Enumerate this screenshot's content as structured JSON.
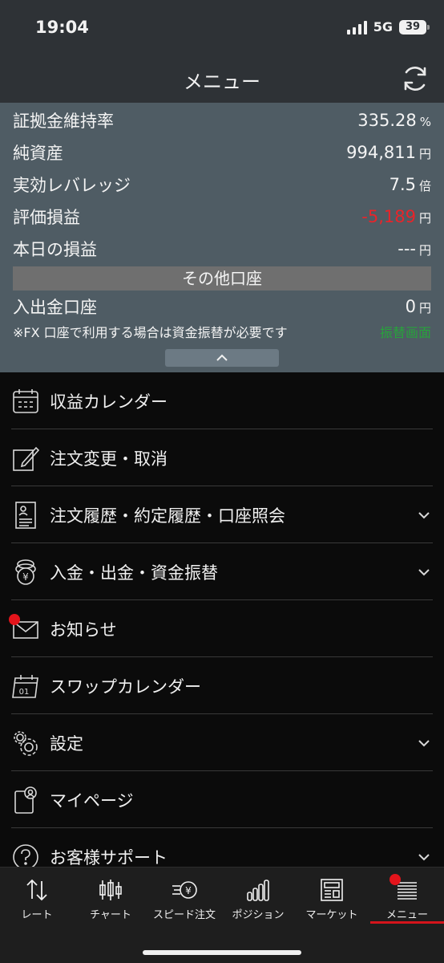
{
  "status": {
    "time": "19:04",
    "network": "5G",
    "battery": "39"
  },
  "header": {
    "title": "メニュー"
  },
  "account": {
    "rows": [
      {
        "label": "証拠金維持率",
        "value": "335.28",
        "unit": "%"
      },
      {
        "label": "純資産",
        "value": "994,811",
        "unit": "円"
      },
      {
        "label": "実効レバレッジ",
        "value": "7.5",
        "unit": "倍"
      },
      {
        "label": "評価損益",
        "value": "-5,189",
        "unit": "円"
      },
      {
        "label": "本日の損益",
        "value": "---",
        "unit": "円"
      }
    ],
    "other_section": "その他口座",
    "deposit_row": {
      "label": "入出金口座",
      "value": "0",
      "unit": "円"
    },
    "note": "※FX 口座で利用する場合は資金振替が必要です",
    "transfer_link": "振替画面"
  },
  "menu": {
    "items": [
      {
        "label": "収益カレンダー",
        "icon": "calendar-icon"
      },
      {
        "label": "注文変更・取消",
        "icon": "edit-icon"
      },
      {
        "label": "注文履歴・約定履歴・口座照会",
        "icon": "document-icon"
      },
      {
        "label": "入金・出金・資金振替",
        "icon": "coins-icon"
      },
      {
        "label": "お知らせ",
        "icon": "mail-icon"
      },
      {
        "label": "スワップカレンダー",
        "icon": "swap-calendar-icon"
      },
      {
        "label": "設定",
        "icon": "gear-icon"
      },
      {
        "label": "マイページ",
        "icon": "mypage-icon"
      },
      {
        "label": "お客様サポート",
        "icon": "help-icon"
      }
    ]
  },
  "tabs": [
    {
      "label": "レート",
      "icon": "rate-arrows-icon"
    },
    {
      "label": "チャート",
      "icon": "candlestick-icon"
    },
    {
      "label": "スピード注文",
      "icon": "speed-order-icon"
    },
    {
      "label": "ポジション",
      "icon": "bars-icon"
    },
    {
      "label": "マーケット",
      "icon": "newspaper-icon"
    },
    {
      "label": "メニュー",
      "icon": "menu-lines-icon"
    }
  ],
  "colors": {
    "negative": "#e8242a",
    "link": "#27a33b",
    "badge": "#e3141b",
    "active_tab": "#d4141b"
  }
}
